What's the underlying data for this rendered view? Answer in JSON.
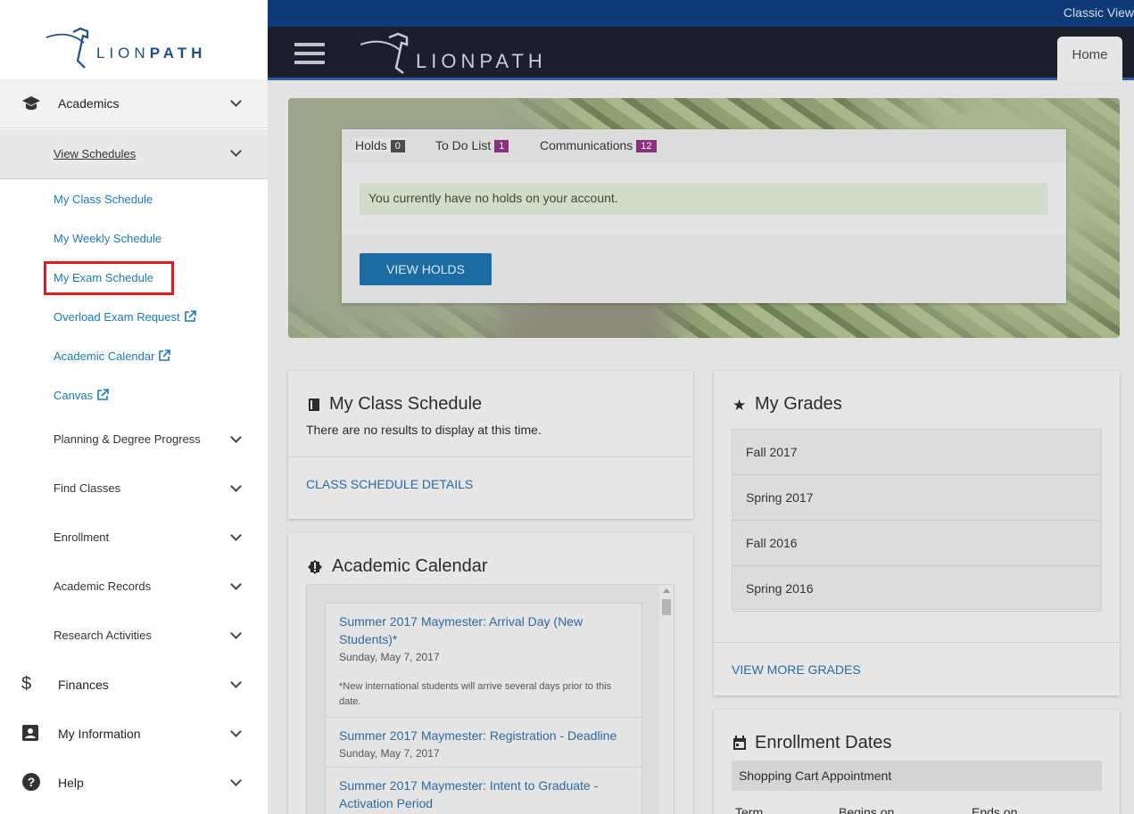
{
  "header": {
    "classic_view": "Classic View",
    "brand": "LIONPATH",
    "home_tab": "Home"
  },
  "alerts": {
    "tabs": [
      {
        "label": "Holds",
        "count": "0"
      },
      {
        "label": "To Do List",
        "count": "1"
      },
      {
        "label": "Communications",
        "count": "12"
      }
    ],
    "message": "You currently have no holds on your account.",
    "button": "VIEW HOLDS"
  },
  "class_schedule": {
    "title": "My Class Schedule",
    "empty": "There are no results to display at this time.",
    "link": "CLASS SCHEDULE DETAILS"
  },
  "grades": {
    "title": "My Grades",
    "terms": [
      "Fall 2017",
      "Spring 2017",
      "Fall 2016",
      "Spring 2016"
    ],
    "link": "VIEW MORE GRADES"
  },
  "calendar": {
    "title": "Academic Calendar",
    "items": [
      {
        "title": "Summer 2017 Maymester: Arrival Day (New Students)*",
        "date": "Sunday, May 7, 2017",
        "note": "*New international students will arrive several days prior to this date."
      },
      {
        "title": "Summer 2017 Maymester: Registration - Deadline",
        "date": "Sunday, May 7, 2017",
        "note": ""
      },
      {
        "title": "Summer 2017 Maymester: Intent to Graduate - Activation Period",
        "date": "",
        "note": ""
      }
    ]
  },
  "enrollment": {
    "title": "Enrollment Dates",
    "subheader": "Shopping Cart Appointment",
    "columns": [
      "Term",
      "Begins on",
      "Ends on"
    ]
  },
  "sidebar": {
    "brand_prefix": "LION",
    "brand_suffix": "PATH",
    "academics": "Academics",
    "view_schedules": "View Schedules",
    "schedule_links": [
      "My Class Schedule",
      "My Weekly Schedule",
      "My Exam Schedule",
      "Overload Exam Request",
      "Academic Calendar",
      "Canvas"
    ],
    "groups": [
      "Planning & Degree Progress",
      "Find Classes",
      "Enrollment",
      "Academic Records",
      "Research Activities"
    ],
    "finances": "Finances",
    "my_information": "My Information",
    "help": "Help"
  }
}
